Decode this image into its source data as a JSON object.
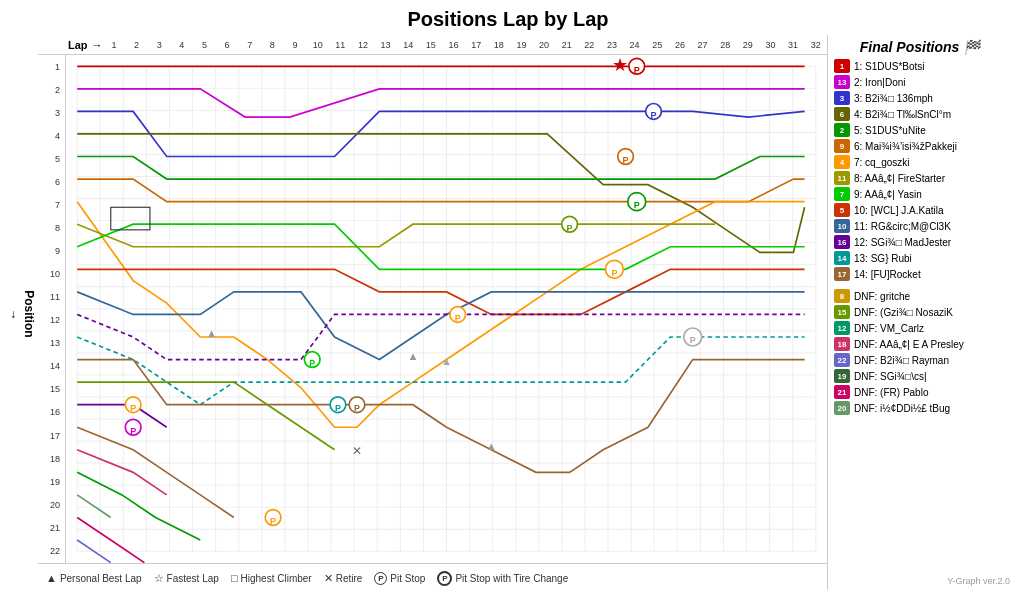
{
  "title": "Positions Lap by Lap",
  "chart": {
    "x_label": "Lap",
    "y_label": "Position",
    "laps": [
      "1",
      "2",
      "3",
      "4",
      "5",
      "6",
      "7",
      "8",
      "9",
      "10",
      "11",
      "12",
      "13",
      "14",
      "15",
      "16",
      "17",
      "18",
      "19",
      "20",
      "21",
      "22",
      "23",
      "24",
      "25",
      "26",
      "27",
      "28",
      "29",
      "30",
      "31",
      "32"
    ],
    "positions": [
      "1",
      "2",
      "3",
      "4",
      "5",
      "6",
      "7",
      "8",
      "9",
      "10",
      "11",
      "12",
      "13",
      "14",
      "15",
      "16",
      "17",
      "18",
      "19",
      "20",
      "21",
      "22"
    ]
  },
  "legend": {
    "title": "Final Positions",
    "finishers": [
      {
        "pos": "1",
        "color": "#cc0000",
        "text": "1: S1DUS*Botsi"
      },
      {
        "pos": "13",
        "color": "#cc00cc",
        "text": "2: Iron|Doni"
      },
      {
        "pos": "3",
        "color": "#3333cc",
        "text": "3: B2i¾□ 136mph"
      },
      {
        "pos": "6",
        "color": "#666600",
        "text": "4: B2i¾□ Tl‰lSnCl°m"
      },
      {
        "pos": "2",
        "color": "#009900",
        "text": "5: S1DUS*uNite"
      },
      {
        "pos": "9",
        "color": "#cc6600",
        "text": "6: Mai¾i¾'isi¾žPakkeji"
      },
      {
        "pos": "4",
        "color": "#ff9900",
        "text": "7: cq_goszki"
      },
      {
        "pos": "11",
        "color": "#999900",
        "text": "8: AAâ„¢| FireStarter"
      },
      {
        "pos": "7",
        "color": "#00cc00",
        "text": "9: AAâ„¢| Yasin"
      },
      {
        "pos": "5",
        "color": "#cc3300",
        "text": "10: [WCL] J.A.Katila"
      },
      {
        "pos": "10",
        "color": "#336699",
        "text": "11: RG&circ;M@Cl3K"
      },
      {
        "pos": "16",
        "color": "#660099",
        "text": "12: SGi¾□ MadJester"
      },
      {
        "pos": "14",
        "color": "#009999",
        "text": "13: SG} Rubi"
      },
      {
        "pos": "17",
        "color": "#996633",
        "text": "14: [FU]Rocket"
      }
    ],
    "dnf": [
      {
        "pos": "8",
        "color": "#cc9900",
        "text": "DNF: gritche"
      },
      {
        "pos": "15",
        "color": "#669900",
        "text": "DNF: (Gzi¾□ NosaziK"
      },
      {
        "pos": "12",
        "color": "#009966",
        "text": "DNF: VM_Carlz"
      },
      {
        "pos": "18",
        "color": "#cc3366",
        "text": "DNF: AAâ„¢| E A Presley"
      },
      {
        "pos": "22",
        "color": "#6666cc",
        "text": "DNF: B2i¾□ Rayman"
      },
      {
        "pos": "19",
        "color": "#336633",
        "text": "DNF: SGi¾□\\cs|"
      },
      {
        "pos": "21",
        "color": "#cc0066",
        "text": "DNF: (FR) Pablo"
      },
      {
        "pos": "20",
        "color": "#669966",
        "text": "DNF: i½¢DDi½£ tBug"
      }
    ]
  },
  "footer": {
    "items": [
      {
        "icon": "▲",
        "label": "Personal Best Lap"
      },
      {
        "icon": "☆",
        "label": "Fastest Lap"
      },
      {
        "icon": "□",
        "label": "Highest Climber"
      },
      {
        "icon": "✕",
        "label": "Retire"
      },
      {
        "icon": "Ⓟ",
        "label": "Pit Stop"
      },
      {
        "icon": "Ⓟ",
        "label": "Pit Stop with Tire Change"
      }
    ]
  },
  "version": "Y-Graph ver.2.0"
}
